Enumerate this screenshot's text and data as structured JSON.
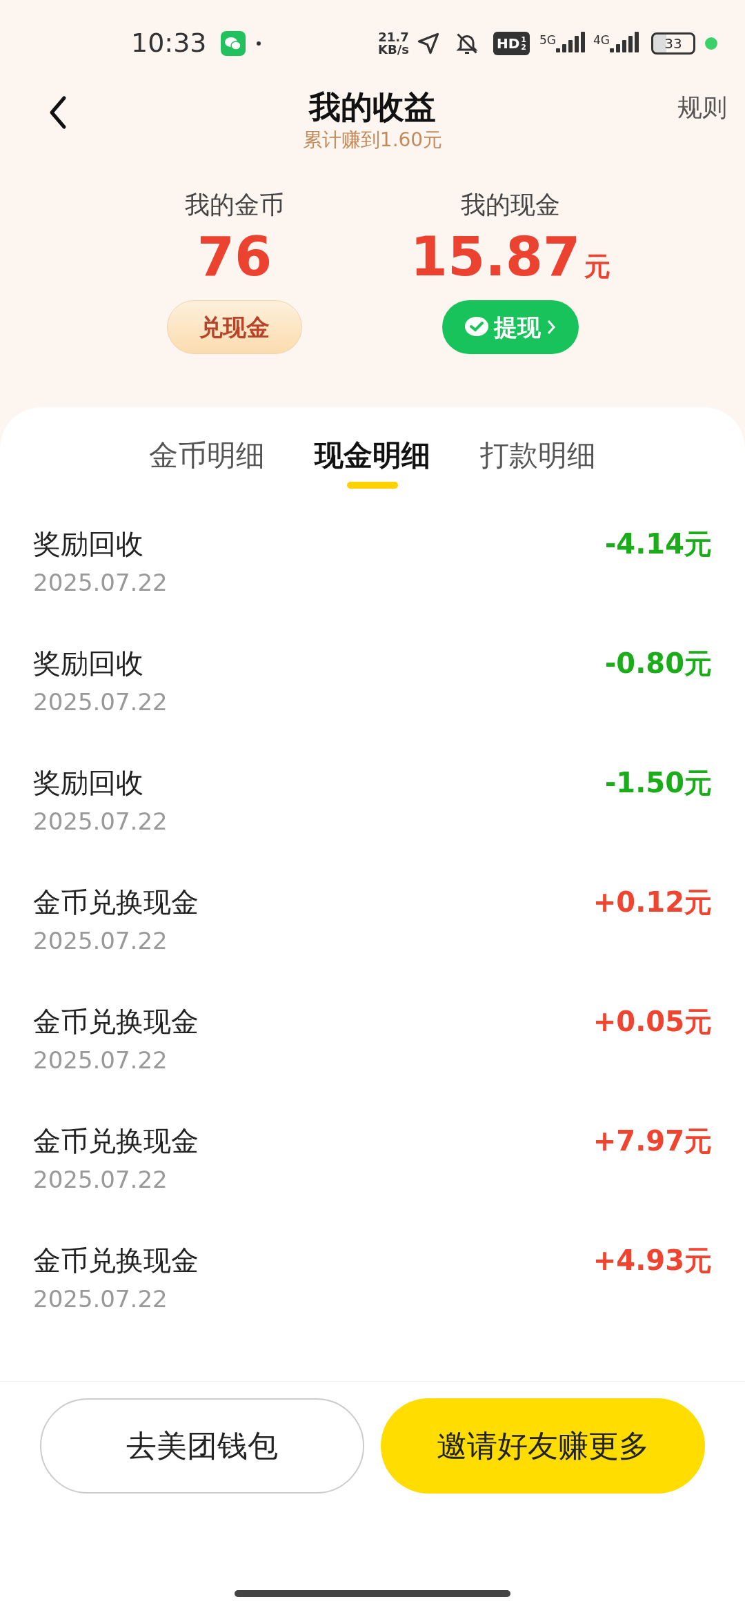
{
  "status_bar": {
    "time": "10:33",
    "speed_value": "21.7",
    "speed_unit": "KB/s",
    "hd": "HD",
    "hd_sup": "1",
    "hd_sub": "2",
    "net1": "5G",
    "net2": "4G",
    "battery": "33"
  },
  "header": {
    "title": "我的收益",
    "subtitle": "累计赚到1.60元",
    "rules": "规则"
  },
  "summary": [
    {
      "label": "我的金币",
      "value": "76",
      "button": "兑现金",
      "kind": "coins"
    },
    {
      "label": "我的现金",
      "value": "15.87",
      "unit": "元",
      "button": "提现",
      "kind": "cash"
    }
  ],
  "tabs": [
    {
      "label": "金币明细",
      "selected": false
    },
    {
      "label": "现金明细",
      "selected": true
    },
    {
      "label": "打款明细",
      "selected": false
    }
  ],
  "records": [
    {
      "title": "奖励回收",
      "date": "2025.07.22",
      "amount": "-4.14元",
      "color": "#1aad19"
    },
    {
      "title": "奖励回收",
      "date": "2025.07.22",
      "amount": "-0.80元",
      "color": "#1aad19"
    },
    {
      "title": "奖励回收",
      "date": "2025.07.22",
      "amount": "-1.50元",
      "color": "#1aad19"
    },
    {
      "title": "金币兑换现金",
      "date": "2025.07.22",
      "amount": "+0.12元",
      "color": "#ee4430"
    },
    {
      "title": "金币兑换现金",
      "date": "2025.07.22",
      "amount": "+0.05元",
      "color": "#ee4430"
    },
    {
      "title": "金币兑换现金",
      "date": "2025.07.22",
      "amount": "+7.97元",
      "color": "#ee4430"
    },
    {
      "title": "金币兑换现金",
      "date": "2025.07.22",
      "amount": "+4.93元",
      "color": "#ee4430"
    }
  ],
  "bottom_buttons": [
    {
      "label": "去美团钱包",
      "kind": "outline"
    },
    {
      "label": "邀请好友赚更多",
      "kind": "primary"
    }
  ]
}
